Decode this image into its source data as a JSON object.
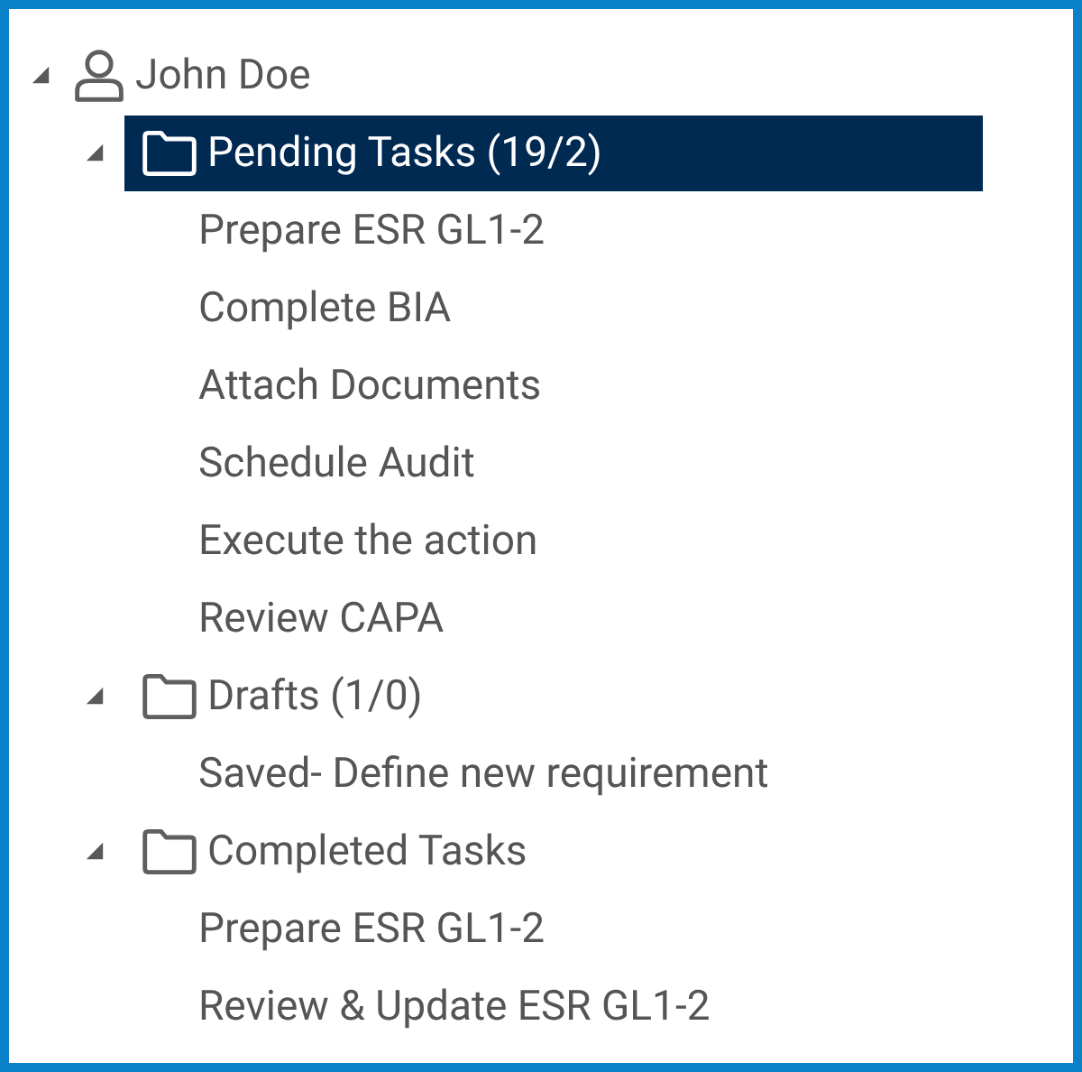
{
  "tree": {
    "label": "John Doe",
    "expanded": true,
    "selected": false,
    "children": [
      {
        "label": "Pending Tasks (19/2)",
        "expanded": true,
        "selected": true,
        "children": [
          {
            "label": "Prepare ESR GL1-2",
            "selected": false
          },
          {
            "label": "Complete BIA",
            "selected": false
          },
          {
            "label": "Attach Documents",
            "selected": false
          },
          {
            "label": "Schedule Audit",
            "selected": false
          },
          {
            "label": "Execute the action",
            "selected": false
          },
          {
            "label": "Review CAPA",
            "selected": false
          }
        ]
      },
      {
        "label": "Drafts (1/0)",
        "expanded": true,
        "selected": false,
        "children": [
          {
            "label": "Saved- Define new requirement",
            "selected": false
          }
        ]
      },
      {
        "label": "Completed Tasks",
        "expanded": true,
        "selected": false,
        "children": [
          {
            "label": "Prepare ESR GL1-2",
            "selected": false
          },
          {
            "label": "Review & Update ESR GL1-2",
            "selected": false
          }
        ]
      }
    ]
  }
}
